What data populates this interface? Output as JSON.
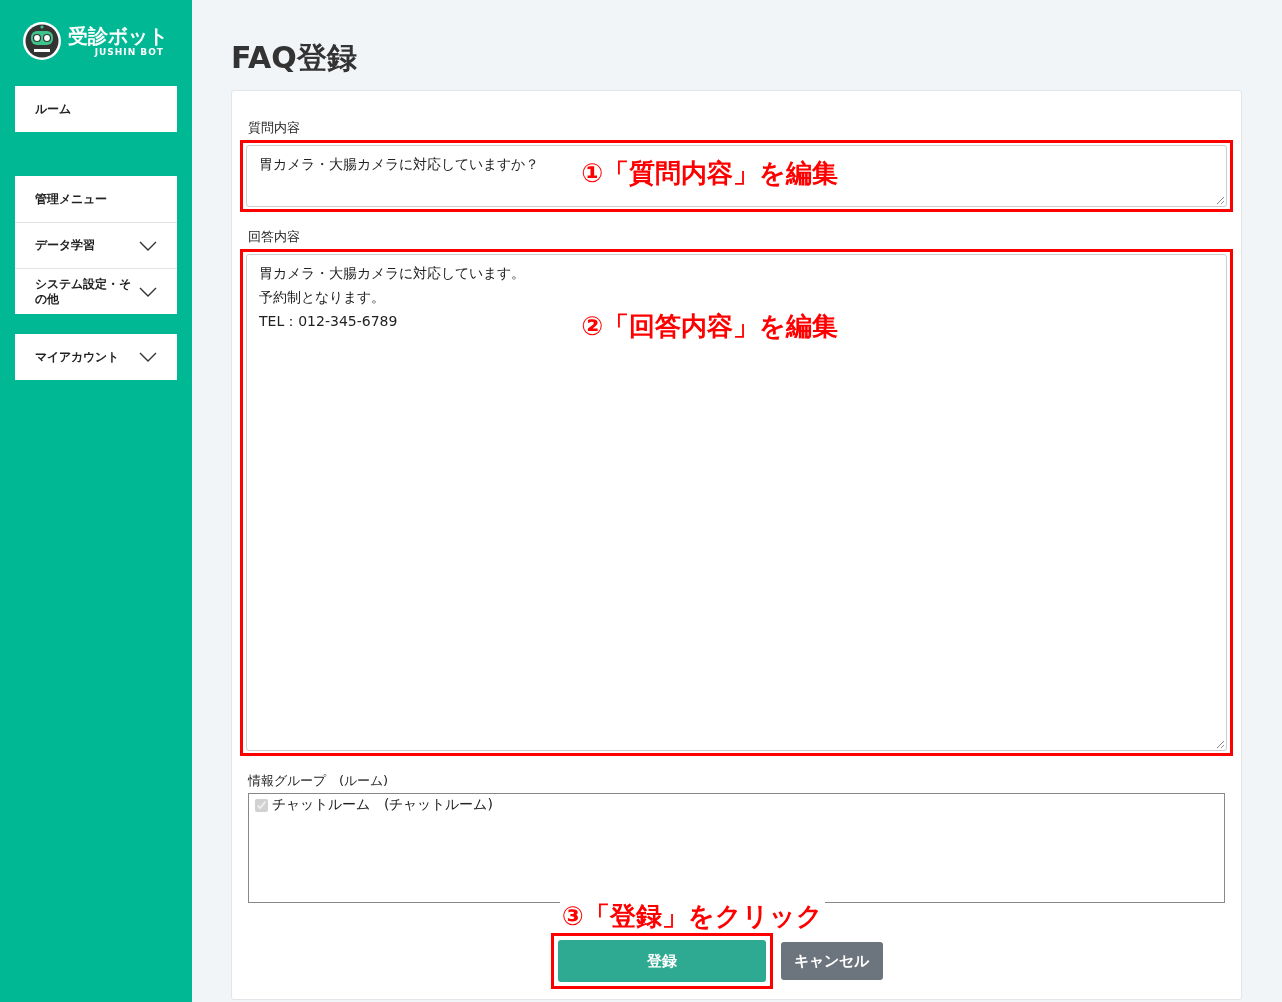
{
  "sidebar": {
    "logo": {
      "title": "受診ボット",
      "subtitle": "JUSHIN BOT"
    },
    "groups": [
      {
        "items": [
          {
            "label": "ルーム",
            "expandable": false
          }
        ]
      },
      {
        "items": [
          {
            "label": "管理メニュー",
            "expandable": false
          },
          {
            "label": "データ学習",
            "expandable": true
          },
          {
            "label": "システム設定・その他",
            "expandable": true
          }
        ]
      },
      {
        "items": [
          {
            "label": "マイアカウント",
            "expandable": true
          }
        ]
      }
    ]
  },
  "page": {
    "title": "FAQ登録"
  },
  "form": {
    "fields": [
      {
        "kind": "textarea",
        "label": "質問内容",
        "lines": [
          "胃カメラ・大腸カメラに対応していますか？"
        ],
        "highlighted": true,
        "annotation": "①「質問内容」を編集"
      },
      {
        "kind": "textarea",
        "label": "回答内容",
        "lines": [
          "胃カメラ・大腸カメラに対応しています。",
          "予約制となります。",
          "TEL：012-345-6789"
        ],
        "highlighted": true,
        "annotation": "②「回答内容」を編集"
      },
      {
        "kind": "checklist",
        "label": "情報グループ　(ルーム)",
        "options": [
          {
            "label": "チャットルーム　(チャットルーム)",
            "checked": true,
            "disabled": true
          }
        ]
      }
    ],
    "buttons": [
      {
        "kind": "primary",
        "label": "登録",
        "highlighted": true,
        "annotation": "③「登録」をクリック"
      },
      {
        "kind": "secondary",
        "label": "キャンセル",
        "highlighted": false
      }
    ]
  }
}
